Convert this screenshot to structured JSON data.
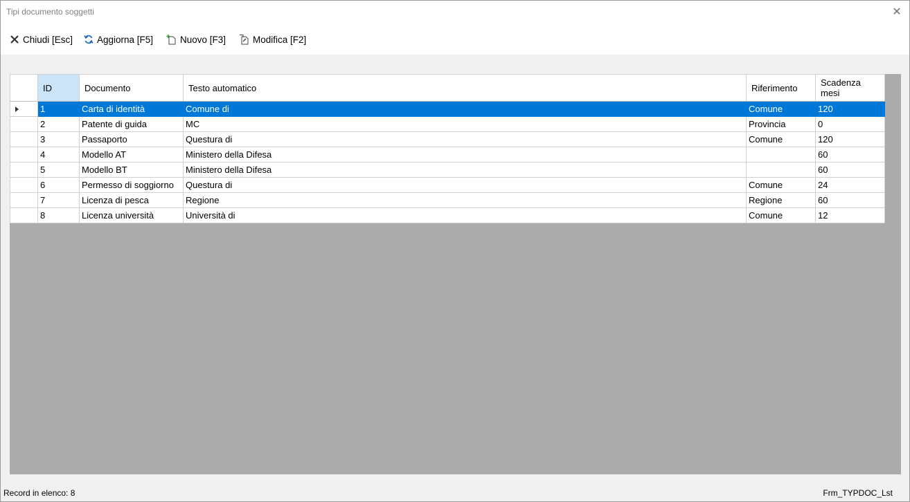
{
  "window": {
    "title": "Tipi documento soggetti",
    "close_glyph": "✕"
  },
  "toolbar": {
    "buttons": [
      {
        "label": "Chiudi [Esc]",
        "icon": "close-icon"
      },
      {
        "label": "Aggiorna [F5]",
        "icon": "refresh-icon"
      },
      {
        "label": "Nuovo [F3]",
        "icon": "new-document-icon"
      },
      {
        "label": "Modifica [F2]",
        "icon": "edit-document-icon"
      }
    ]
  },
  "grid": {
    "columns": [
      {
        "label": "ID"
      },
      {
        "label": "Documento"
      },
      {
        "label": "Testo automatico"
      },
      {
        "label": "Riferimento"
      },
      {
        "label": "Scadenza mesi"
      }
    ],
    "sorted_column": "ID",
    "selected_row": 0,
    "rows": [
      [
        "1",
        "Carta di identità",
        "Comune di",
        "Comune",
        "120"
      ],
      [
        "2",
        "Patente di guida",
        "MC",
        "Provincia",
        "0"
      ],
      [
        "3",
        "Passaporto",
        "Questura di",
        "Comune",
        "120"
      ],
      [
        "4",
        "Modello AT",
        "Ministero della Difesa",
        "",
        "60"
      ],
      [
        "5",
        "Modello BT",
        "Ministero della Difesa",
        "",
        "60"
      ],
      [
        "6",
        "Permesso di soggiorno",
        "Questura di",
        "Comune",
        "24"
      ],
      [
        "7",
        "Licenza di pesca",
        "Regione",
        "Regione",
        "60"
      ],
      [
        "8",
        "Licenza università",
        "Università di",
        "Comune",
        "12"
      ]
    ]
  },
  "status": {
    "record_count": "Record in elenco: 8",
    "form_name": "Frm_TYPDOC_Lst"
  },
  "colors": {
    "selection": "#0078d7",
    "sorted_header": "#cce4f7",
    "grid_background": "#ababab"
  }
}
